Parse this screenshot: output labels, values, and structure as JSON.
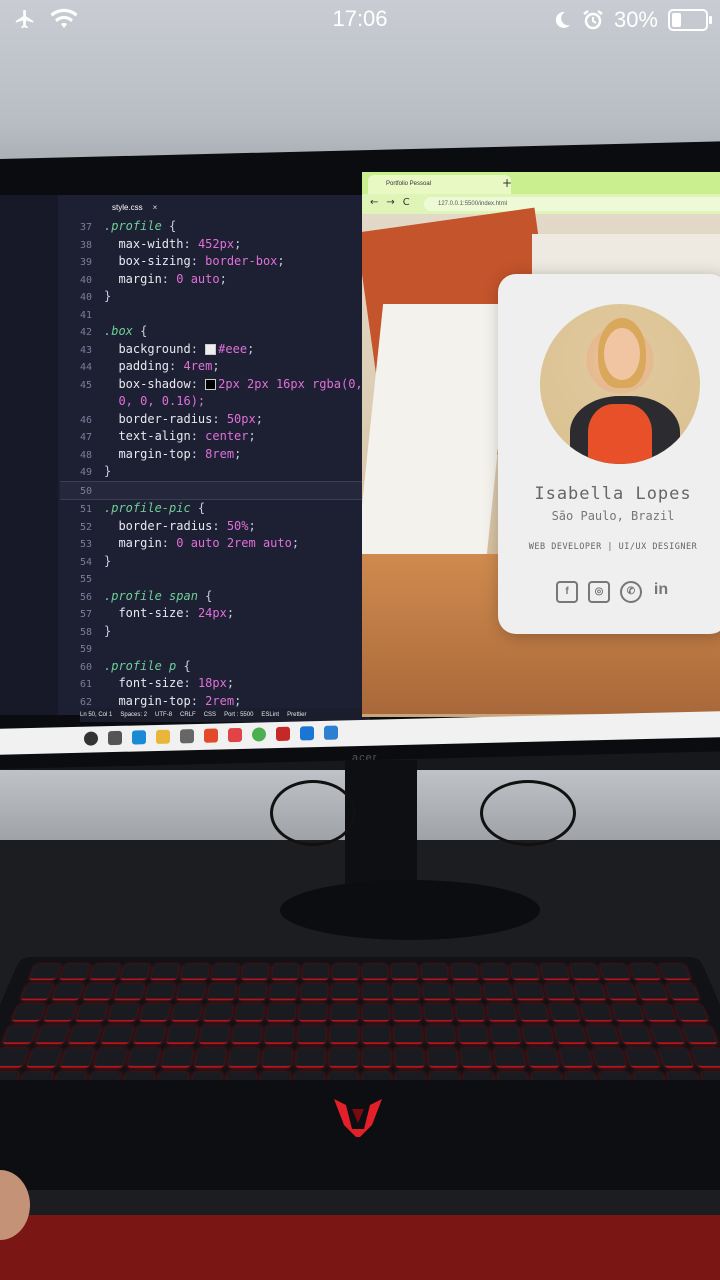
{
  "status_bar": {
    "time": "17:06",
    "battery": "30%",
    "icons": [
      "airplane-icon",
      "wifi-icon",
      "moon-icon",
      "alarm-icon",
      "battery-icon"
    ]
  },
  "editor": {
    "tab_label": "style.css",
    "lines": [
      {
        "n": "37",
        "sel": ".profile",
        "rest": " {"
      },
      {
        "n": "38",
        "prop": "max-width",
        "val": "452px"
      },
      {
        "n": "39",
        "prop": "box-sizing",
        "val": "border-box"
      },
      {
        "n": "40",
        "prop": "margin",
        "val": "0 auto"
      },
      {
        "n": "40",
        "raw": "}"
      },
      {
        "n": "41",
        "raw": ""
      },
      {
        "n": "42",
        "sel": ".box",
        "rest": " {"
      },
      {
        "n": "43",
        "prop": "background",
        "val": "#eee",
        "swatch": "#eeeeee"
      },
      {
        "n": "44",
        "prop": "padding",
        "val": "4rem"
      },
      {
        "n": "45",
        "prop": "box-shadow",
        "val": "2px 2px 16px rgba(0,",
        "swatch2": "#000000"
      },
      {
        "n": "",
        "val_only": "0, 0, 0.16);"
      },
      {
        "n": "46",
        "prop": "border-radius",
        "val": "50px"
      },
      {
        "n": "47",
        "prop": "text-align",
        "val": "center"
      },
      {
        "n": "48",
        "prop": "margin-top",
        "val": "8rem"
      },
      {
        "n": "49",
        "raw": "}"
      },
      {
        "n": "50",
        "raw": "",
        "active": true
      },
      {
        "n": "51",
        "sel": ".profile-pic",
        "rest": " {"
      },
      {
        "n": "52",
        "prop": "border-radius",
        "val": "50%"
      },
      {
        "n": "53",
        "prop": "margin",
        "val": "0 auto 2rem auto"
      },
      {
        "n": "54",
        "raw": "}"
      },
      {
        "n": "55",
        "raw": ""
      },
      {
        "n": "56",
        "sel": ".profile span",
        "rest": " {"
      },
      {
        "n": "57",
        "prop": "font-size",
        "val": "24px"
      },
      {
        "n": "58",
        "raw": "}"
      },
      {
        "n": "59",
        "raw": ""
      },
      {
        "n": "60",
        "sel": ".profile p",
        "rest": " {"
      },
      {
        "n": "61",
        "prop": "font-size",
        "val": "18px"
      },
      {
        "n": "62",
        "prop": "margin-top",
        "val": "2rem"
      }
    ],
    "statusbar": [
      "Ln 50, Col 1",
      "Spaces: 2",
      "UTF-8",
      "CRLF",
      "CSS",
      "Port : 5500",
      "ESLint",
      "Prettier"
    ]
  },
  "browser": {
    "tab_title": "Portfolio Pessoal",
    "url": "127.0.0.1:5500/index.html",
    "card": {
      "name": "Isabella Lopes",
      "location": "São Paulo, Brazil",
      "role": "WEB DEVELOPER | UI/UX DESIGNER",
      "socials": [
        "facebook-icon",
        "instagram-icon",
        "whatsapp-icon",
        "linkedin-icon"
      ]
    }
  },
  "monitor_brand": "acer",
  "colors": {
    "editor_bg": "#1d1f33",
    "selector": "#6fcf97",
    "value": "#e070d8",
    "browser_chrome": "#c9ef8e",
    "keyboard_glow": "#e0201f"
  }
}
